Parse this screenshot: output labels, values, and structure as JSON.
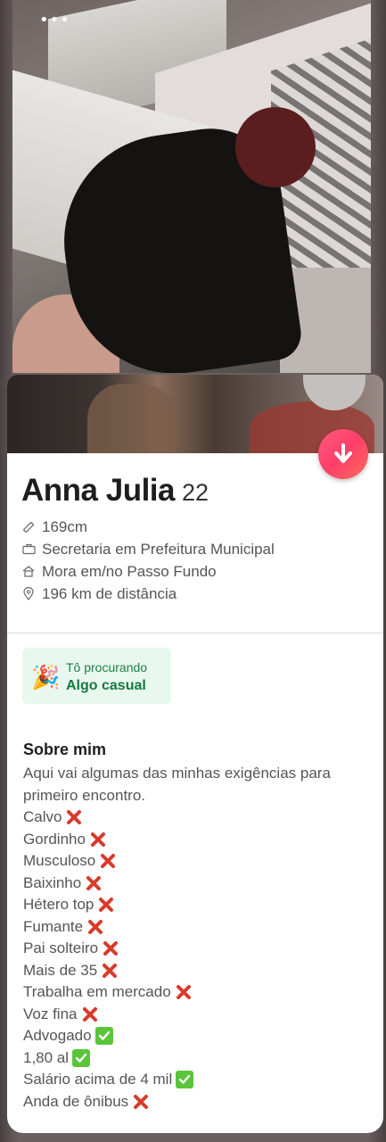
{
  "status_bar": {
    "dots": "•••"
  },
  "profile": {
    "name": "Anna Julia",
    "age": "22",
    "height": "169cm",
    "job": "Secretaria em Prefeitura Municipal",
    "lives": "Mora em/no Passo Fundo",
    "distance": "196 km de distância"
  },
  "looking_for": {
    "label": "Tô procurando",
    "value": "Algo casual"
  },
  "about": {
    "title": "Sobre mim",
    "intro": "Aqui vai algumas das minhas exigências para primeiro encontro.",
    "items": [
      {
        "text": "Calvo",
        "mark": "cross"
      },
      {
        "text": "Gordinho",
        "mark": "cross"
      },
      {
        "text": "Musculoso",
        "mark": "cross"
      },
      {
        "text": "Baixinho",
        "mark": "cross"
      },
      {
        "text": "Hétero top",
        "mark": "cross"
      },
      {
        "text": "Fumante",
        "mark": "cross"
      },
      {
        "text": "Pai solteiro",
        "mark": "cross"
      },
      {
        "text": "Mais de 35",
        "mark": "cross"
      },
      {
        "text": "Trabalha em mercado",
        "mark": "cross"
      },
      {
        "text": "Voz fina",
        "mark": "cross"
      },
      {
        "text": "Advogado",
        "mark": "check"
      },
      {
        "text": "1,80 al",
        "mark": "check"
      },
      {
        "text": "Salário acima de 4 mil",
        "mark": "check"
      },
      {
        "text": "Anda de ônibus",
        "mark": "cross"
      }
    ]
  },
  "colors": {
    "accent": "#fd3f6a",
    "cross": "#d93a2b",
    "check": "#5ac53a",
    "looking_bg": "#e9f8ef",
    "looking_text": "#137a3e"
  },
  "icons": {
    "more": "more-dots-icon",
    "height": "ruler-icon",
    "job": "briefcase-icon",
    "lives": "home-icon",
    "distance": "location-pin-icon",
    "down": "arrow-down-icon",
    "looking": "party-popper-icon"
  }
}
